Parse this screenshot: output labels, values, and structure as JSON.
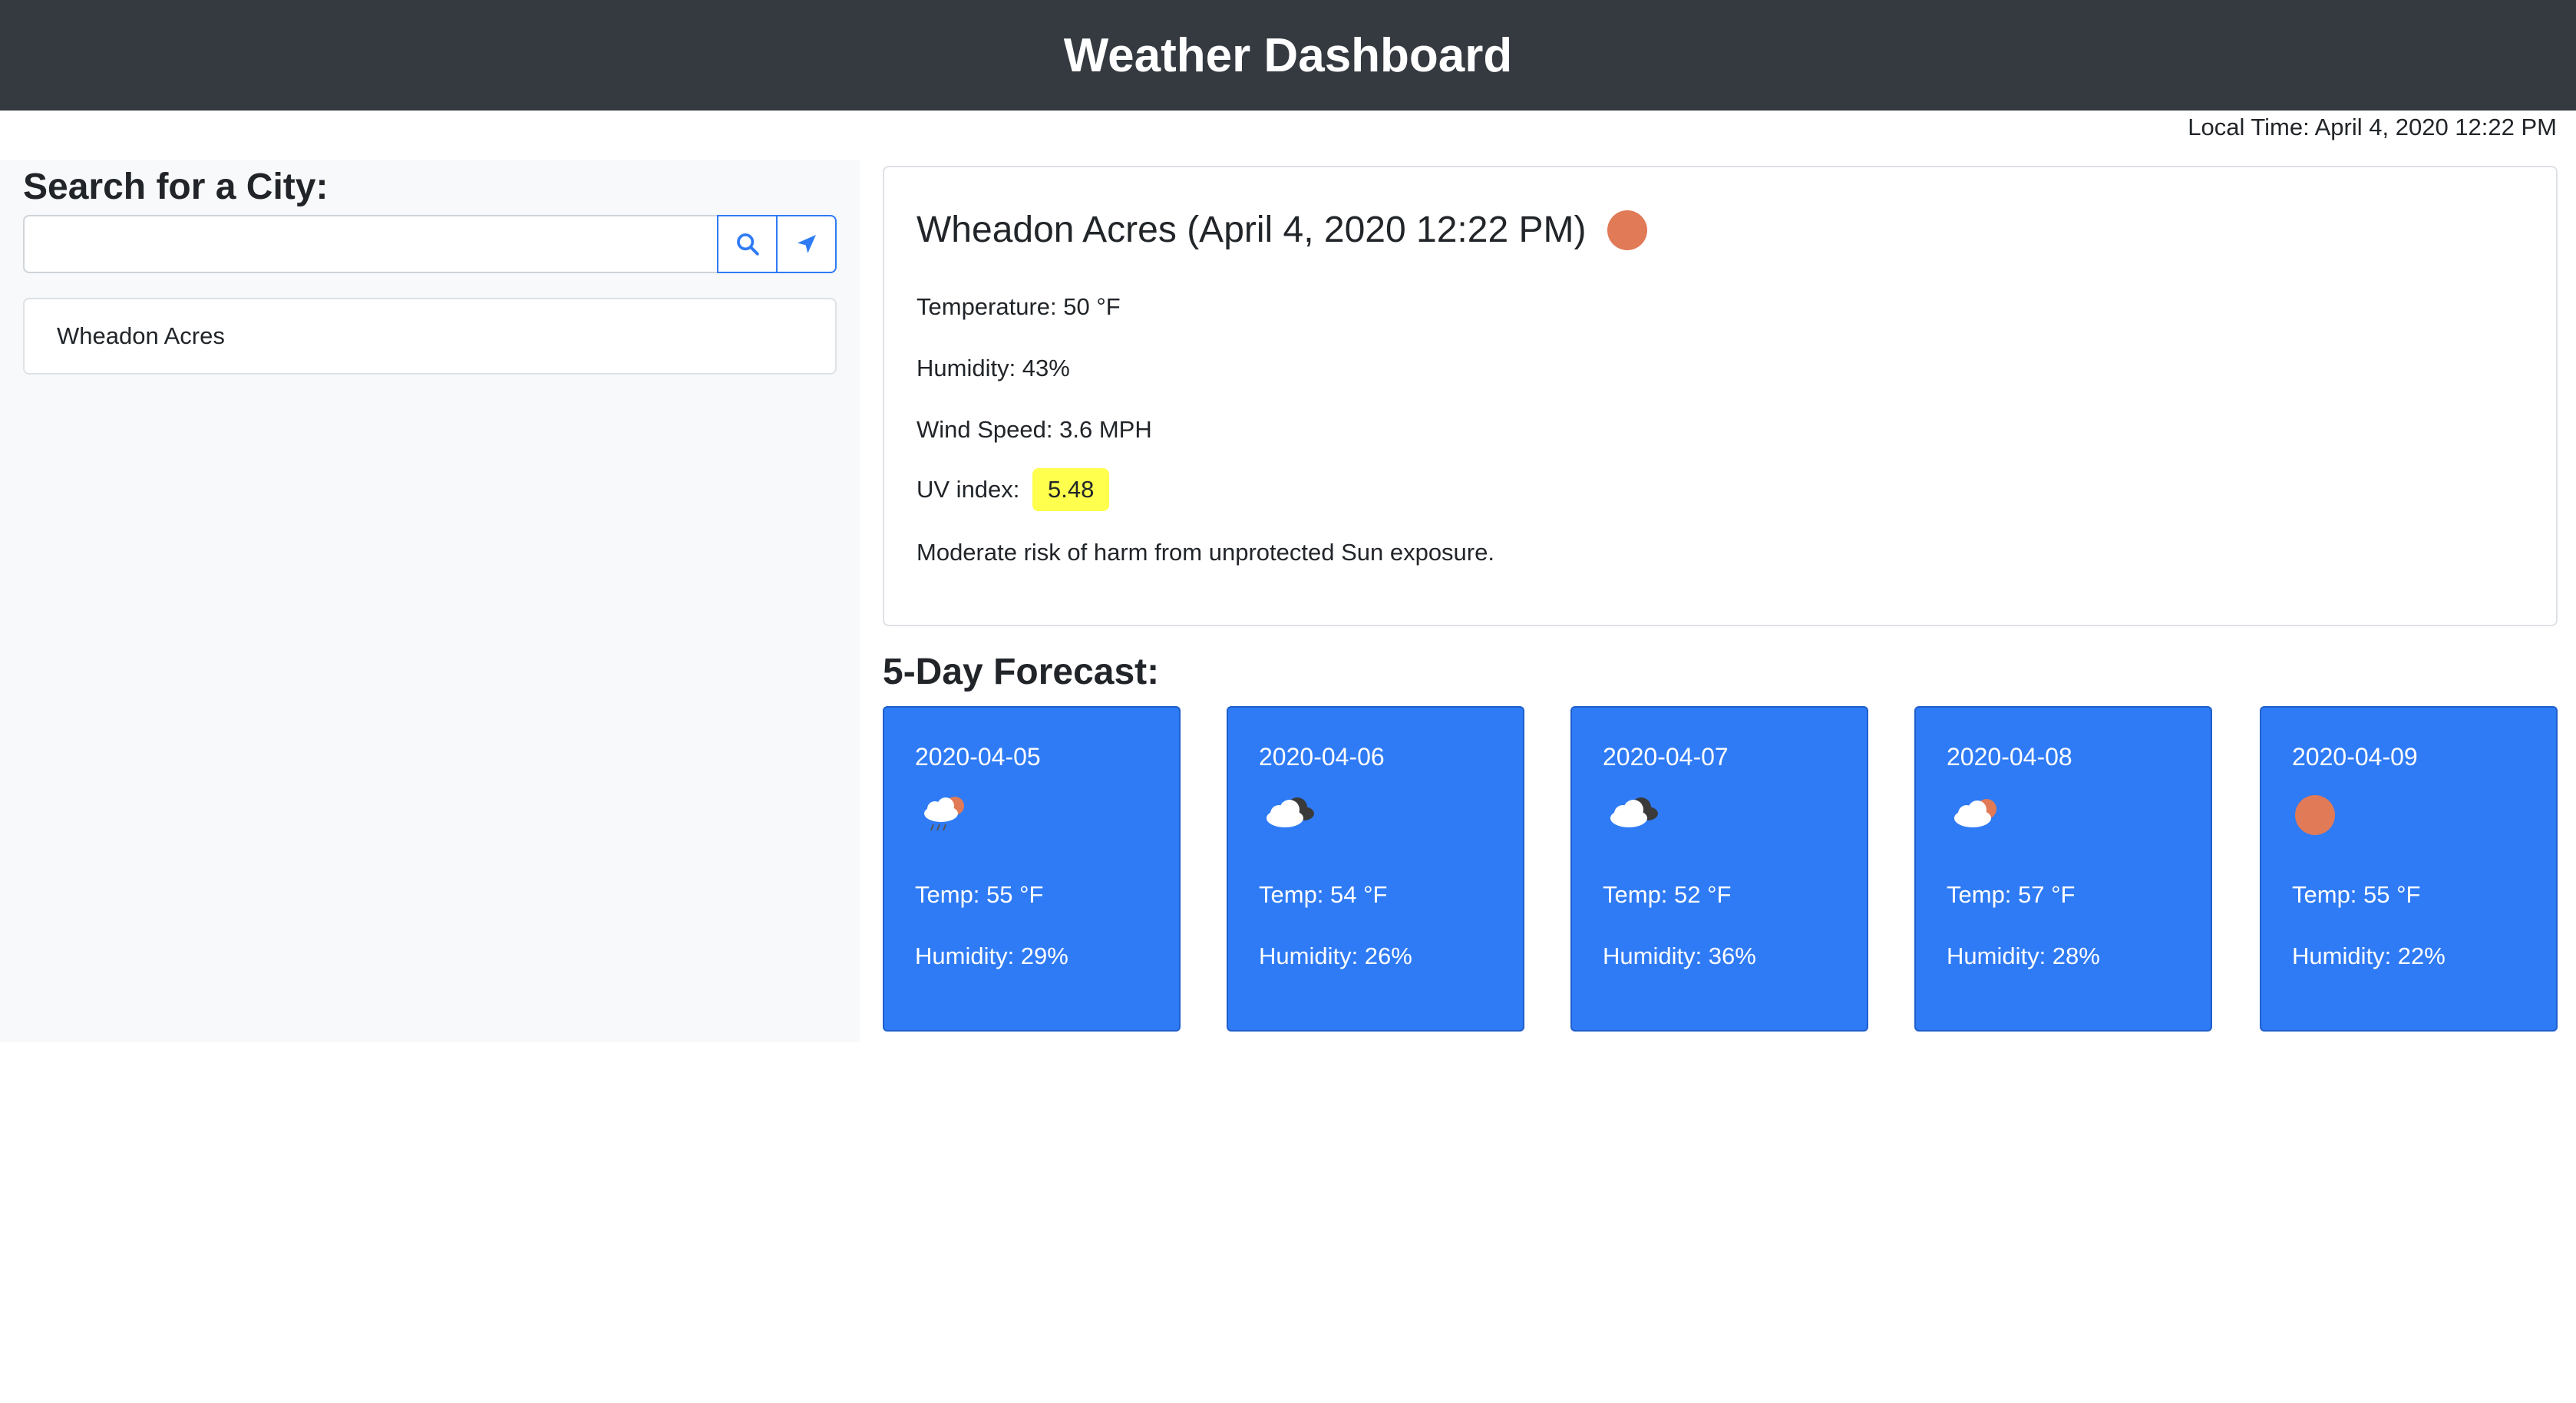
{
  "header": {
    "title": "Weather Dashboard"
  },
  "local_time": "Local Time: April 4, 2020 12:22 PM",
  "sidebar": {
    "title": "Search for a City:",
    "search": {
      "value": "",
      "placeholder": ""
    },
    "search_icon": "search-icon",
    "location_icon": "location-arrow-icon",
    "history": [
      {
        "label": "Wheadon Acres"
      }
    ]
  },
  "current": {
    "title": "Wheadon Acres (April 4, 2020 12:22 PM)",
    "icon": "sun-icon",
    "temperature": "Temperature: 50 °F",
    "humidity": "Humidity: 43%",
    "wind": "Wind Speed: 3.6 MPH",
    "uv_label": "UV index:",
    "uv_value": "5.48",
    "uv_color": "#ffff4d",
    "risk": "Moderate risk of harm from unprotected Sun exposure."
  },
  "forecast": {
    "title": "5-Day Forecast:",
    "card_color": "#2f7bf5",
    "days": [
      {
        "date": "2020-04-05",
        "icon": "rain-sun-icon",
        "temp": "Temp: 55 °F",
        "humidity": "Humidity: 29%"
      },
      {
        "date": "2020-04-06",
        "icon": "cloudy-icon",
        "temp": "Temp: 54 °F",
        "humidity": "Humidity: 26%"
      },
      {
        "date": "2020-04-07",
        "icon": "cloudy-icon",
        "temp": "Temp: 52 °F",
        "humidity": "Humidity: 36%"
      },
      {
        "date": "2020-04-08",
        "icon": "partly-cloudy-icon",
        "temp": "Temp: 57 °F",
        "humidity": "Humidity: 28%"
      },
      {
        "date": "2020-04-09",
        "icon": "sun-icon",
        "temp": "Temp: 55 °F",
        "humidity": "Humidity: 22%"
      }
    ]
  }
}
